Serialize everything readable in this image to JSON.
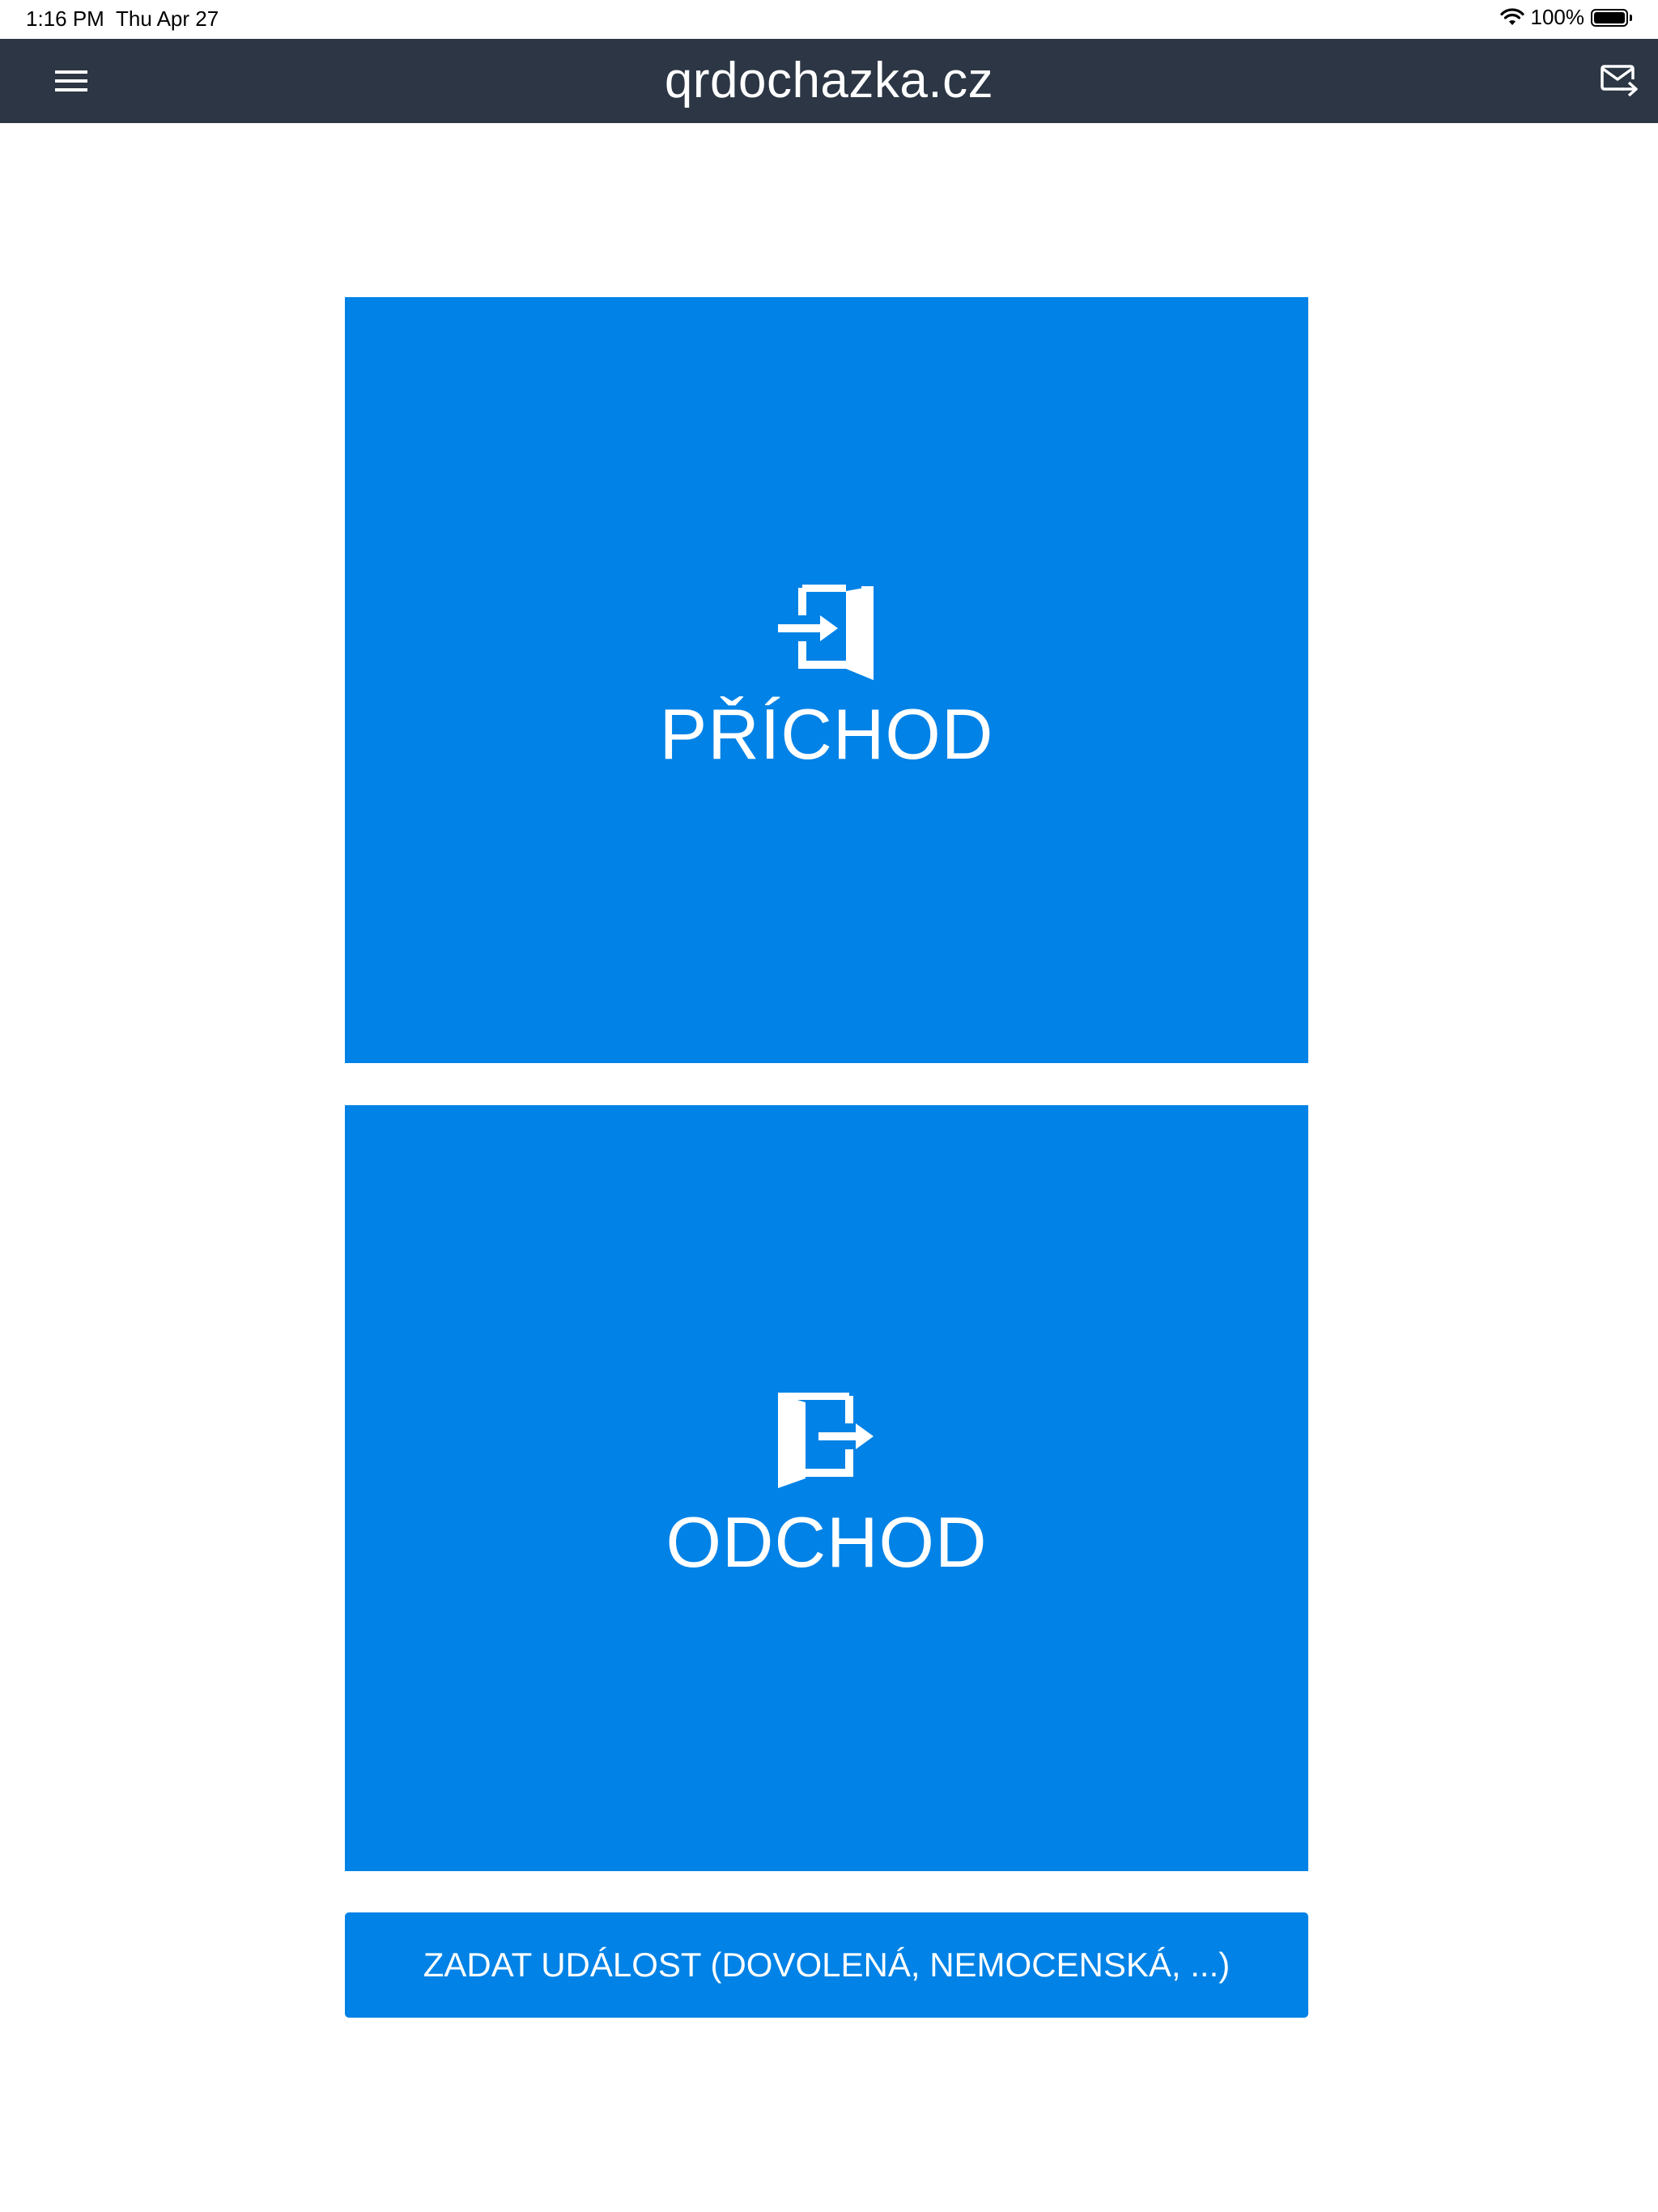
{
  "status_bar": {
    "time": "1:16 PM",
    "date": "Thu Apr 27",
    "battery": "100%",
    "icons": [
      "wifi-icon",
      "battery-icon"
    ]
  },
  "app_bar": {
    "title": "qrdochazka.cz",
    "left_icon": "menu-icon",
    "right_icon": "mail-forward-icon"
  },
  "actions": {
    "arrival_label": "PŘÍCHOD",
    "arrival_icon": "door-enter-icon",
    "departure_label": "ODCHOD",
    "departure_icon": "door-exit-icon",
    "event_label": "ZADAT UDÁLOST (DOVOLENÁ, NEMOCENSKÁ, ...)"
  },
  "colors": {
    "app_bar": "#2c3644",
    "primary": "#0082e6",
    "background": "#ffffff"
  }
}
